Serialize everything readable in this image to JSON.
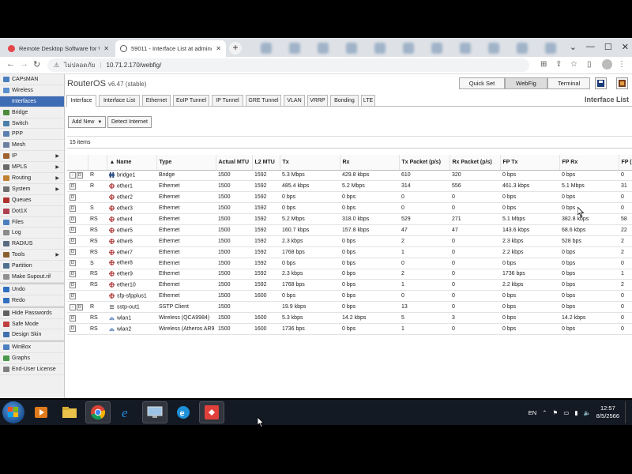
{
  "browser": {
    "tabs": [
      {
        "title": "Remote Desktop Software for W",
        "active": false
      },
      {
        "title": "59011 - Interface List at admin@",
        "active": true
      }
    ],
    "security_label": "ไม่ปลอดภัย",
    "url": "10.71.2.170/webfig/"
  },
  "routeros": {
    "title": "RouterOS",
    "version": "v6.47 (stable)",
    "modes": [
      "Quick Set",
      "WebFig",
      "Terminal"
    ],
    "selected_mode": "WebFig"
  },
  "sidebar": {
    "items": [
      {
        "label": "CAPsMAN",
        "icon_color": "#4a7fbf",
        "arrow": false
      },
      {
        "label": "Wireless",
        "icon_color": "#5a8fd0",
        "arrow": false
      },
      {
        "label": "Interfaces",
        "icon_color": "#3d6eb3",
        "arrow": false,
        "active": true
      },
      {
        "label": "Bridge",
        "icon_color": "#4b8b3b",
        "arrow": false
      },
      {
        "label": "Switch",
        "icon_color": "#4c7fa8",
        "arrow": false
      },
      {
        "label": "PPP",
        "icon_color": "#5b7fb0",
        "arrow": false
      },
      {
        "label": "Mesh",
        "icon_color": "#6b7fa0",
        "arrow": false
      },
      {
        "label": "IP",
        "icon_color": "#a06030",
        "arrow": true
      },
      {
        "label": "MPLS",
        "icon_color": "#6a6a6a",
        "arrow": true
      },
      {
        "label": "Routing",
        "icon_color": "#c08030",
        "arrow": true
      },
      {
        "label": "System",
        "icon_color": "#707070",
        "arrow": true
      },
      {
        "label": "Queues",
        "icon_color": "#b03030",
        "arrow": false
      },
      {
        "label": "Dot1X",
        "icon_color": "#b04050",
        "arrow": false
      },
      {
        "label": "Files",
        "icon_color": "#4a7fbf",
        "arrow": false
      },
      {
        "label": "Log",
        "icon_color": "#8a8a8a",
        "arrow": false
      },
      {
        "label": "RADIUS",
        "icon_color": "#5a6a80",
        "arrow": false
      },
      {
        "label": "Tools",
        "icon_color": "#8a6030",
        "arrow": true
      },
      {
        "label": "Partition",
        "icon_color": "#507090",
        "arrow": false
      },
      {
        "label": "Make Supout.rif",
        "icon_color": "#909090",
        "arrow": false
      }
    ],
    "items2": [
      {
        "label": "Undo",
        "icon_color": "#3070c0"
      },
      {
        "label": "Redo",
        "icon_color": "#3070c0"
      }
    ],
    "items3": [
      {
        "label": "Hide Passwords",
        "icon_color": "#606060"
      },
      {
        "label": "Safe Mode",
        "icon_color": "#c04040"
      },
      {
        "label": "Design Skin",
        "icon_color": "#4070b0"
      }
    ],
    "items4": [
      {
        "label": "WinBox",
        "icon_color": "#4a7fbf"
      },
      {
        "label": "Graphs",
        "icon_color": "#4a9a4a"
      },
      {
        "label": "End-User License",
        "icon_color": "#808080"
      }
    ]
  },
  "tabs": [
    "Interface",
    "Interface List",
    "Ethernet",
    "EoIP Tunnel",
    "IP Tunnel",
    "GRE Tunnel",
    "VLAN",
    "VRRP",
    "Bonding",
    "LTE"
  ],
  "section_title": "Interface List",
  "actions": {
    "add_new": "Add New",
    "detect_internet": "Detect Internet"
  },
  "item_count": "15 items",
  "table": {
    "columns": [
      "",
      "",
      "▲ Name",
      "Type",
      "Actual MTU",
      "L2 MTU",
      "Tx",
      "Rx",
      "Tx Packet (p/s)",
      "Rx Packet (p/s)",
      "FP Tx",
      "FP Rx",
      "FP (p"
    ],
    "rows": [
      {
        "btns": [
          "-",
          "D"
        ],
        "flag": "R",
        "name": "bridge1",
        "icon": "bridge",
        "type": "Bridge",
        "mtu": "1500",
        "l2mtu": "1592",
        "tx": "5.3 Mbps",
        "rx": "429.8 kbps",
        "txp": "610",
        "rxp": "320",
        "fptx": "0 bps",
        "fprx": "0 bps",
        "fpp": "0"
      },
      {
        "btns": [
          "D"
        ],
        "flag": "R",
        "name": "ether1",
        "icon": "ether",
        "type": "Ethernet",
        "mtu": "1500",
        "l2mtu": "1592",
        "tx": "485.4 kbps",
        "rx": "5.2 Mbps",
        "txp": "314",
        "rxp": "556",
        "fptx": "461.3 kbps",
        "fprx": "5.1 Mbps",
        "fpp": "31"
      },
      {
        "btns": [
          "D"
        ],
        "flag": "",
        "name": "ether2",
        "icon": "ether",
        "type": "Ethernet",
        "mtu": "1500",
        "l2mtu": "1592",
        "tx": "0 bps",
        "rx": "0 bps",
        "txp": "0",
        "rxp": "0",
        "fptx": "0 bps",
        "fprx": "0 bps",
        "fpp": "0"
      },
      {
        "btns": [
          "D"
        ],
        "flag": "S",
        "name": "ether3",
        "icon": "ether",
        "type": "Ethernet",
        "mtu": "1500",
        "l2mtu": "1592",
        "tx": "0 bps",
        "rx": "0 bps",
        "txp": "0",
        "rxp": "0",
        "fptx": "0 bps",
        "fprx": "0 bps",
        "fpp": "0"
      },
      {
        "btns": [
          "D"
        ],
        "flag": "RS",
        "name": "ether4",
        "icon": "ether",
        "type": "Ethernet",
        "mtu": "1500",
        "l2mtu": "1592",
        "tx": "5.2 Mbps",
        "rx": "318.0 kbps",
        "txp": "529",
        "rxp": "271",
        "fptx": "5.1 Mbps",
        "fprx": "382.8 kbps",
        "fpp": "58"
      },
      {
        "btns": [
          "D"
        ],
        "flag": "RS",
        "name": "ether5",
        "icon": "ether",
        "type": "Ethernet",
        "mtu": "1500",
        "l2mtu": "1592",
        "tx": "160.7 kbps",
        "rx": "157.8 kbps",
        "txp": "47",
        "rxp": "47",
        "fptx": "143.6 kbps",
        "fprx": "68.6 kbps",
        "fpp": "22"
      },
      {
        "btns": [
          "D"
        ],
        "flag": "RS",
        "name": "ether6",
        "icon": "ether",
        "type": "Ethernet",
        "mtu": "1500",
        "l2mtu": "1592",
        "tx": "2.3 kbps",
        "rx": "0 bps",
        "txp": "2",
        "rxp": "0",
        "fptx": "2.3 kbps",
        "fprx": "528 bps",
        "fpp": "2"
      },
      {
        "btns": [
          "D"
        ],
        "flag": "RS",
        "name": "ether7",
        "icon": "ether",
        "type": "Ethernet",
        "mtu": "1500",
        "l2mtu": "1592",
        "tx": "1768 bps",
        "rx": "0 bps",
        "txp": "1",
        "rxp": "0",
        "fptx": "2.2 kbps",
        "fprx": "0 bps",
        "fpp": "2"
      },
      {
        "btns": [
          "D"
        ],
        "flag": "S",
        "name": "ether8",
        "icon": "ether",
        "type": "Ethernet",
        "mtu": "1500",
        "l2mtu": "1592",
        "tx": "0 bps",
        "rx": "0 bps",
        "txp": "0",
        "rxp": "0",
        "fptx": "0 bps",
        "fprx": "0 bps",
        "fpp": "0"
      },
      {
        "btns": [
          "D"
        ],
        "flag": "RS",
        "name": "ether9",
        "icon": "ether",
        "type": "Ethernet",
        "mtu": "1500",
        "l2mtu": "1592",
        "tx": "2.3 kbps",
        "rx": "0 bps",
        "txp": "2",
        "rxp": "0",
        "fptx": "1736 bps",
        "fprx": "0 bps",
        "fpp": "1"
      },
      {
        "btns": [
          "D"
        ],
        "flag": "RS",
        "name": "ether10",
        "icon": "ether",
        "type": "Ethernet",
        "mtu": "1500",
        "l2mtu": "1592",
        "tx": "1768 bps",
        "rx": "0 bps",
        "txp": "1",
        "rxp": "0",
        "fptx": "2.2 kbps",
        "fprx": "0 bps",
        "fpp": "2"
      },
      {
        "btns": [
          "D"
        ],
        "flag": "",
        "name": "sfp-sfpplus1",
        "icon": "ether",
        "type": "Ethernet",
        "mtu": "1500",
        "l2mtu": "1600",
        "tx": "0 bps",
        "rx": "0 bps",
        "txp": "0",
        "rxp": "0",
        "fptx": "0 bps",
        "fprx": "0 bps",
        "fpp": "0"
      },
      {
        "btns": [
          "-",
          "D"
        ],
        "flag": "R",
        "name": "sstp-out1",
        "icon": "sstp",
        "type": "SSTP Client",
        "mtu": "1500",
        "l2mtu": "",
        "tx": "19.9 kbps",
        "rx": "0 bps",
        "txp": "13",
        "rxp": "0",
        "fptx": "0 bps",
        "fprx": "0 bps",
        "fpp": "0"
      },
      {
        "btns": [
          "D"
        ],
        "flag": "RS",
        "name": "wlan1",
        "icon": "wlan",
        "type": "Wireless (QCA9984)",
        "mtu": "1500",
        "l2mtu": "1600",
        "tx": "5.3 kbps",
        "rx": "14.2 kbps",
        "txp": "5",
        "rxp": "3",
        "fptx": "0 bps",
        "fprx": "14.2 kbps",
        "fpp": "0"
      },
      {
        "btns": [
          "D"
        ],
        "flag": "RS",
        "name": "wlan2",
        "icon": "wlan",
        "type": "Wireless (Atheros AR9",
        "mtu": "1500",
        "l2mtu": "1600",
        "tx": "1736 bps",
        "rx": "0 bps",
        "txp": "1",
        "rxp": "0",
        "fptx": "0 bps",
        "fprx": "0 bps",
        "fpp": "0"
      }
    ]
  },
  "taskbar": {
    "language": "EN",
    "time": "12:57",
    "date": "8/5/2566"
  }
}
